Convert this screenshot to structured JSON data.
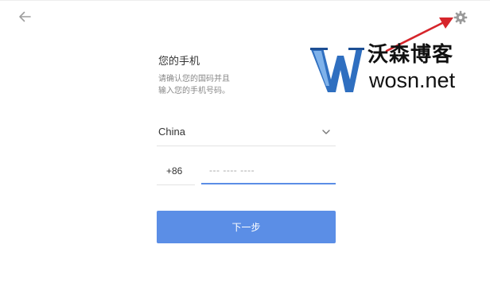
{
  "icons": {
    "back": "back-arrow-icon",
    "settings": "gear-icon",
    "dropdown": "chevron-down-icon"
  },
  "form": {
    "heading": "您的手机",
    "instructions_line1": "请确认您的国码并且",
    "instructions_line2": "输入您的手机号码。",
    "country_value": "China",
    "country_code": "+86",
    "phone_placeholder": "--- ---- ----",
    "next_label": "下一步"
  },
  "watermark": {
    "title": "沃森博客",
    "site": "wosn.net"
  },
  "colors": {
    "accent": "#5b8ee6",
    "arrow": "#d6252b",
    "muted_text": "#888888",
    "border": "#e3e3e3"
  }
}
